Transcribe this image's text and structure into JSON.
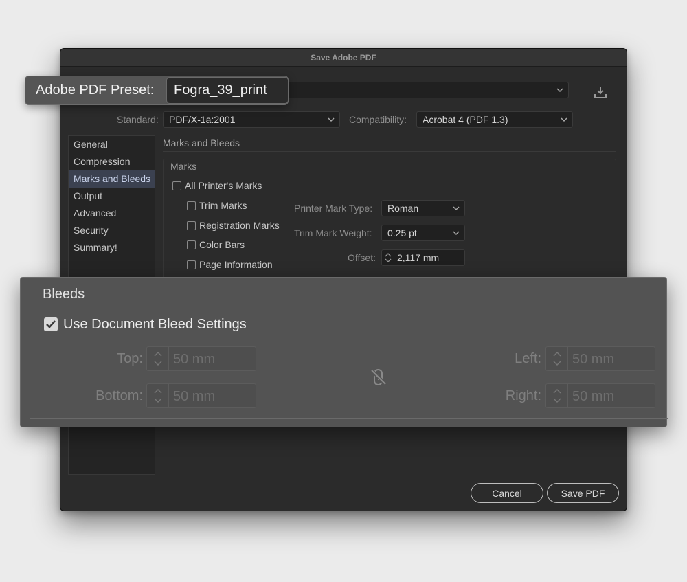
{
  "window": {
    "title": "Save Adobe PDF"
  },
  "preset": {
    "label": "Adobe PDF Preset:",
    "value": "Fogra_39_print"
  },
  "standard": {
    "label": "Standard:",
    "value": "PDF/X-1a:2001"
  },
  "compatibility": {
    "label": "Compatibility:",
    "value": "Acrobat 4 (PDF 1.3)"
  },
  "sidebar": {
    "items": [
      {
        "label": "General",
        "active": false
      },
      {
        "label": "Compression",
        "active": false
      },
      {
        "label": "Marks and Bleeds",
        "active": true
      },
      {
        "label": "Output",
        "active": false
      },
      {
        "label": "Advanced",
        "active": false
      },
      {
        "label": "Security",
        "active": false
      },
      {
        "label": "Summary!",
        "active": false
      }
    ]
  },
  "panel": {
    "title": "Marks and Bleeds"
  },
  "marks": {
    "group_label": "Marks",
    "all_printers_marks": {
      "label": "All Printer's Marks",
      "checked": false
    },
    "items": [
      {
        "label": "Trim Marks",
        "checked": false
      },
      {
        "label": "Registration Marks",
        "checked": false
      },
      {
        "label": "Color Bars",
        "checked": false
      },
      {
        "label": "Page Information",
        "checked": false
      }
    ],
    "printer_mark_type": {
      "label": "Printer Mark Type:",
      "value": "Roman"
    },
    "trim_mark_weight": {
      "label": "Trim Mark Weight:",
      "value": "0.25 pt"
    },
    "offset": {
      "label": "Offset:",
      "value": "2,117 mm"
    }
  },
  "bleeds": {
    "group_label": "Bleeds",
    "use_document": {
      "label": "Use Document Bleed Settings",
      "checked": true
    },
    "top": {
      "label": "Top:",
      "value": "50 mm"
    },
    "bottom": {
      "label": "Bottom:",
      "value": "50 mm"
    },
    "left": {
      "label": "Left:",
      "value": "50 mm"
    },
    "right": {
      "label": "Right:",
      "value": "50 mm"
    }
  },
  "buttons": {
    "cancel": "Cancel",
    "save": "Save PDF"
  },
  "icons": {
    "save_preset": "download-icon",
    "link": "unlink-chain-icon"
  },
  "colors": {
    "dialog_bg": "#2b2b2b",
    "sidebar_active": "#3b4150",
    "overlay_bg": "#535353"
  }
}
